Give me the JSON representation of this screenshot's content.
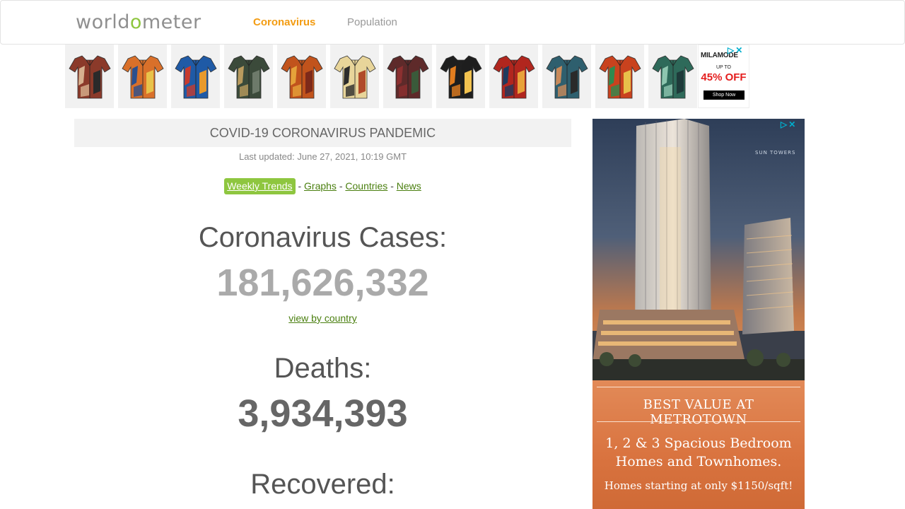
{
  "header": {
    "logo": {
      "part1": "world",
      "o": "o",
      "part2": "meter"
    },
    "nav": [
      {
        "label": "Coronavirus",
        "active": true
      },
      {
        "label": "Population",
        "active": false
      }
    ]
  },
  "banner_ad": {
    "shirt_count": 12,
    "shirts": [
      {
        "colors": [
          "#8b3a2a",
          "#d7b18f",
          "#2a2a2a"
        ]
      },
      {
        "colors": [
          "#d9702a",
          "#2b4f8e",
          "#e8c34a"
        ]
      },
      {
        "colors": [
          "#1f5aa6",
          "#c73b2e",
          "#e89a2c"
        ]
      },
      {
        "colors": [
          "#3b4a3a",
          "#b99a5e",
          "#6d7a6a"
        ]
      },
      {
        "colors": [
          "#c1531c",
          "#e5a23a",
          "#7d2a1a"
        ]
      },
      {
        "colors": [
          "#e8d59a",
          "#2b2b2b",
          "#b04a2a"
        ]
      },
      {
        "colors": [
          "#5e2a2a",
          "#8c3030",
          "#3a5a3a"
        ]
      },
      {
        "colors": [
          "#1e1e1e",
          "#e27d1f",
          "#f2c24f"
        ]
      },
      {
        "colors": [
          "#b1261e",
          "#1e3a5e",
          "#e8a23a"
        ]
      },
      {
        "colors": [
          "#2e5f6e",
          "#c98a5a",
          "#2a2a2a"
        ]
      },
      {
        "colors": [
          "#c9421e",
          "#2e8a4f",
          "#e8c04a"
        ]
      },
      {
        "colors": [
          "#2e6a5a",
          "#8ec6b0",
          "#1e3a3a"
        ]
      }
    ],
    "promo": {
      "brand": "MILAMODE",
      "upto": "UP TO",
      "discount": "45% OFF",
      "cta": "Shop Now"
    },
    "adchoices_icon": "ad-choices-icon",
    "close_icon": "close-icon"
  },
  "main": {
    "title": "COVID-19 CORONAVIRUS PANDEMIC",
    "last_updated": "Last updated: June 27, 2021, 10:19 GMT",
    "links": [
      "Weekly Trends",
      "Graphs",
      "Countries",
      "News"
    ],
    "separator": "-",
    "cases": {
      "label": "Coronavirus Cases:",
      "value": "181,626,332",
      "color": "#aaaaaa"
    },
    "view_by_country": "view by country",
    "deaths": {
      "label": "Deaths:",
      "value": "3,934,393",
      "color": "#666666"
    },
    "recovered": {
      "label": "Recovered:"
    }
  },
  "side_ad": {
    "brand": "SUN TOWERS",
    "headline": "BEST VALUE AT METROTOWN",
    "line1": "1, 2 & 3 Spacious Bedroom",
    "line2": "Homes and Townhomes.",
    "price": "Homes starting at only $1150/sqft!"
  },
  "colors": {
    "accent_green": "#8ec63f",
    "link_green": "#4a7f0f",
    "active_orange": "#f39c12"
  }
}
